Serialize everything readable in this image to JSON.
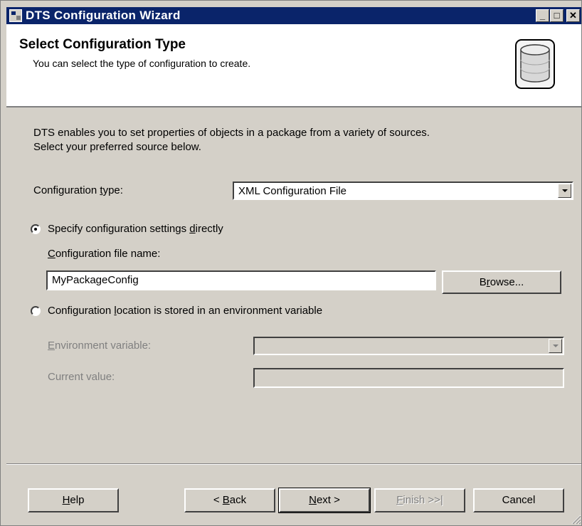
{
  "window": {
    "title": "DTS Configuration Wizard"
  },
  "header": {
    "title": "Select Configuration Type",
    "subtitle": "You can select the type of configuration to create.",
    "icon": "database-icon"
  },
  "intro": {
    "line1": "DTS enables you to set properties of objects in a package from a variety of sources.",
    "line2": "Select your preferred source below."
  },
  "config_type": {
    "label_pre": "Configuration ",
    "label_mnemonic": "t",
    "label_post": "ype:",
    "value": "XML Configuration File"
  },
  "option_direct": {
    "label_pre": "Specify configuration settings ",
    "label_mnemonic": "d",
    "label_post": "irectly",
    "selected": true
  },
  "file_name": {
    "label_mnemonic": "C",
    "label_post": "onfiguration file name:",
    "value": "MyPackageConfig",
    "browse_pre": "B",
    "browse_mnemonic": "r",
    "browse_post": "owse..."
  },
  "option_env": {
    "label_pre": "Configuration ",
    "label_mnemonic": "l",
    "label_post": "ocation is stored in an environment variable",
    "selected": false
  },
  "env_var": {
    "label_mnemonic": "E",
    "label_post": "nvironment variable:",
    "value": ""
  },
  "current_value": {
    "label": "Current value:",
    "value": ""
  },
  "buttons": {
    "help_mnemonic": "H",
    "help_post": "elp",
    "back_pre": "< ",
    "back_mnemonic": "B",
    "back_post": "ack",
    "next_mnemonic": "N",
    "next_post": "ext >",
    "finish_mnemonic": "F",
    "finish_post": "inish >>|",
    "cancel": "Cancel"
  }
}
